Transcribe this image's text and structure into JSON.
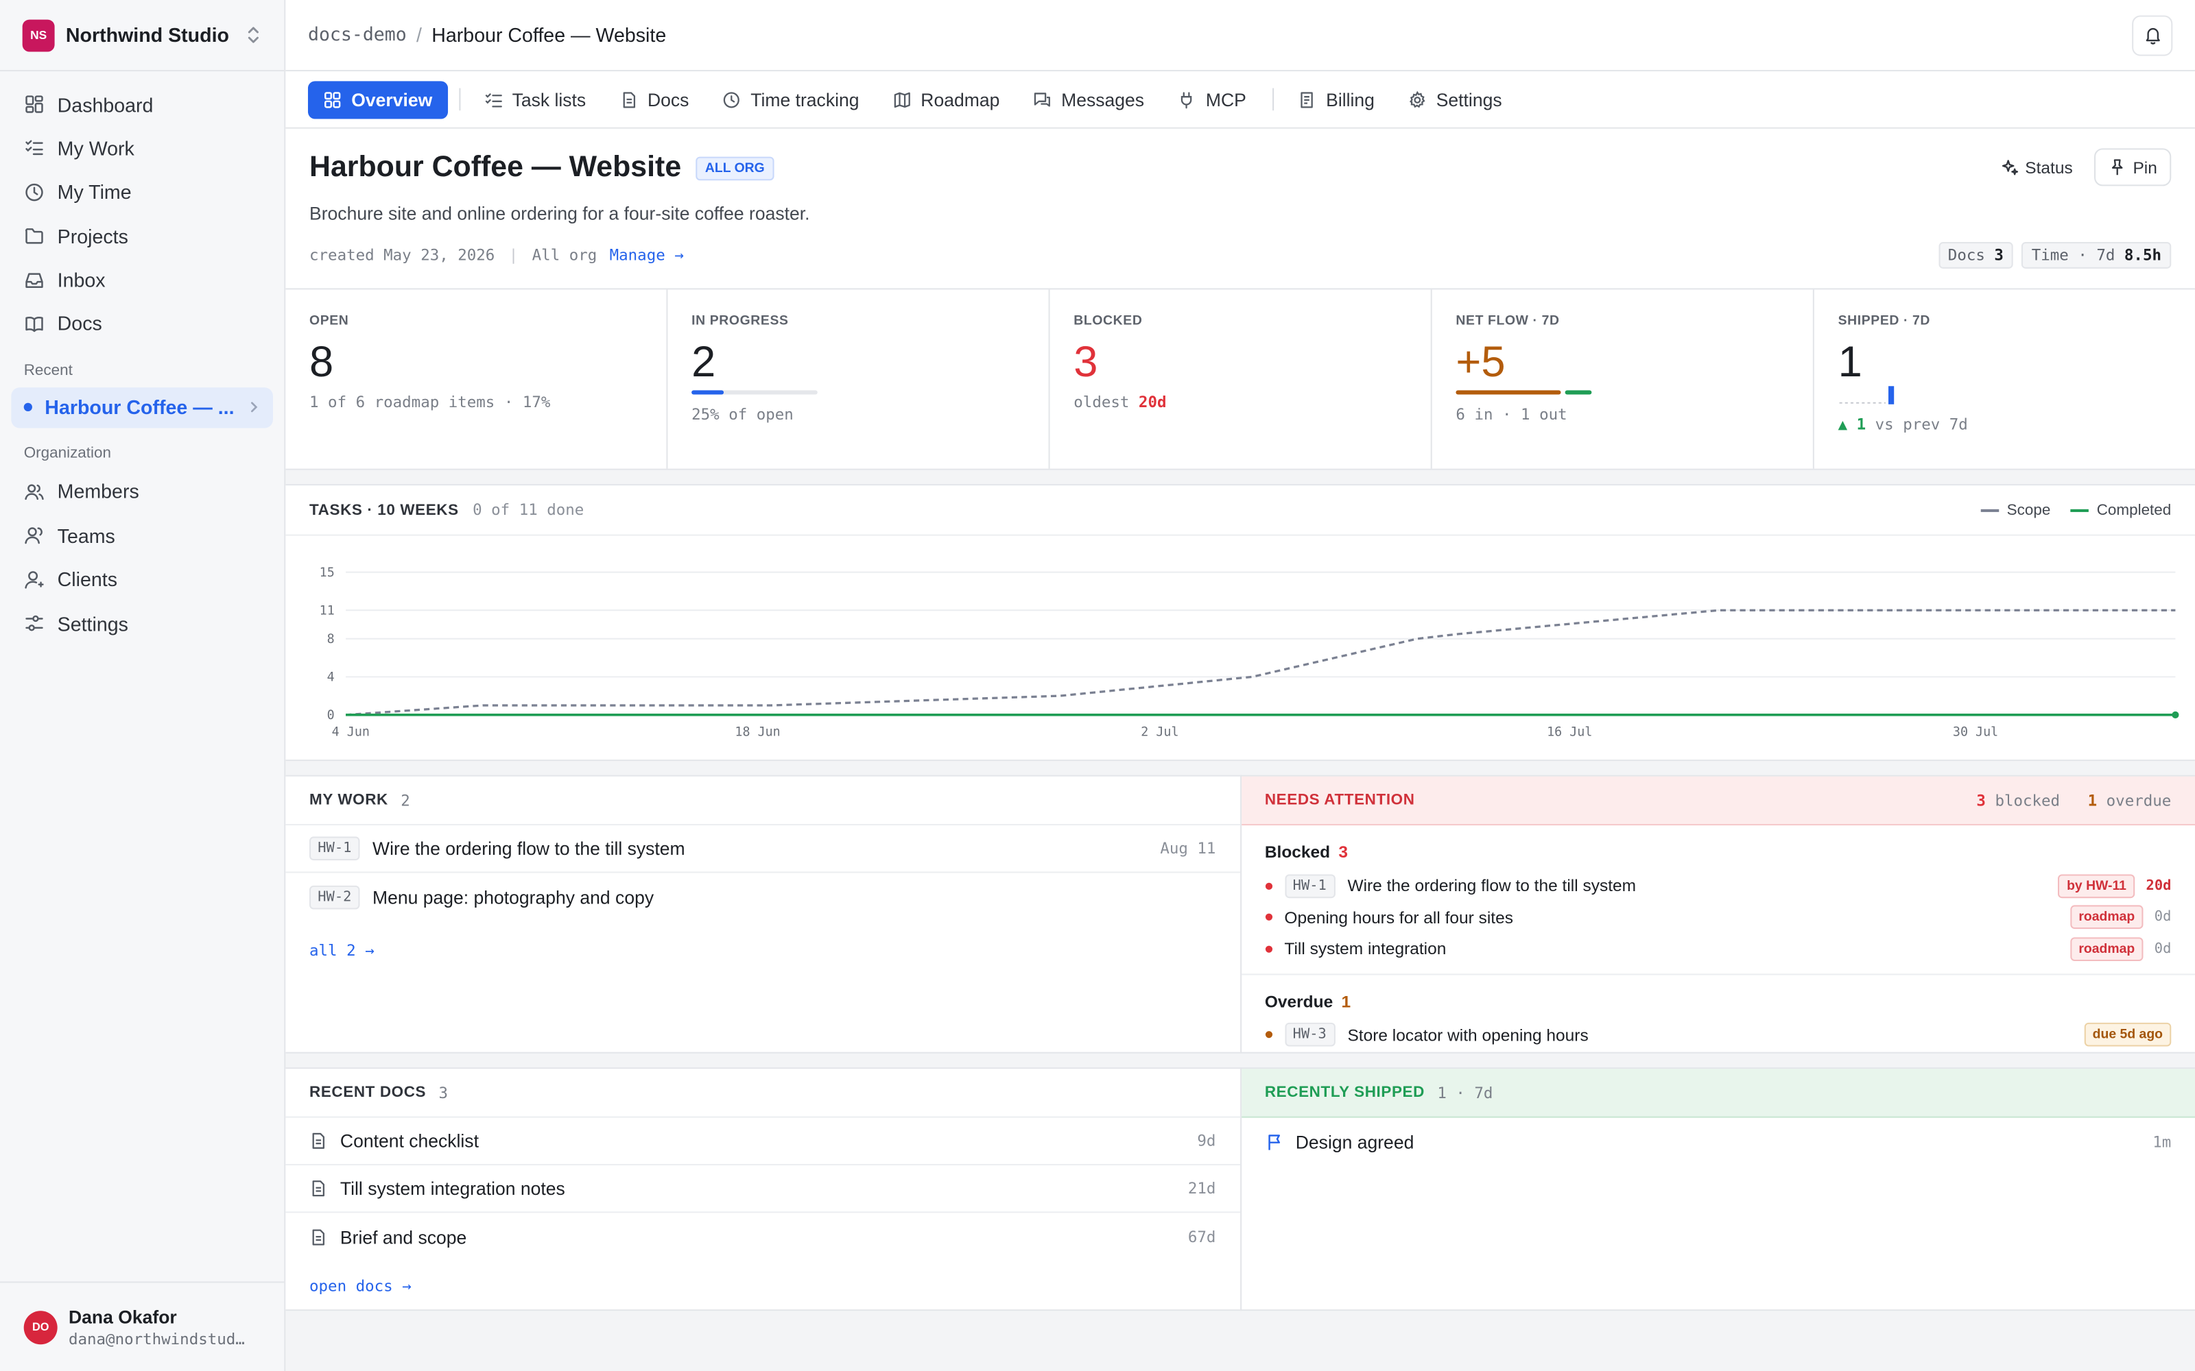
{
  "org": {
    "badge": "NS",
    "name": "Northwind Studio"
  },
  "nav": [
    {
      "label": "Dashboard",
      "icon": "dashboard-icon"
    },
    {
      "label": "My Work",
      "icon": "checklist-icon"
    },
    {
      "label": "My Time",
      "icon": "clock-icon"
    },
    {
      "label": "Projects",
      "icon": "folder-icon"
    },
    {
      "label": "Inbox",
      "icon": "inbox-icon"
    },
    {
      "label": "Docs",
      "icon": "book-icon"
    }
  ],
  "recent": {
    "label": "Recent",
    "item": "Harbour Coffee — ..."
  },
  "organization": {
    "label": "Organization",
    "items": [
      "Members",
      "Teams",
      "Clients",
      "Settings"
    ]
  },
  "user": {
    "initials": "DO",
    "name": "Dana Okafor",
    "email": "dana@northwindstud…"
  },
  "topbar": {
    "slug": "docs-demo",
    "sep": "/",
    "title": "Harbour Coffee — Website"
  },
  "tabs": [
    "Overview",
    "Task lists",
    "Docs",
    "Time tracking",
    "Roadmap",
    "Messages",
    "MCP",
    "Billing",
    "Settings"
  ],
  "project": {
    "title": "Harbour Coffee — Website",
    "scope": "ALL ORG",
    "description": "Brochure site and online ordering for a four-site coffee roaster.",
    "created": "created May 23, 2026",
    "visibility": "All org",
    "manage": "Manage →",
    "status_btn": "Status",
    "pin_btn": "Pin",
    "docs_chip_label": "Docs",
    "docs_chip_value": "3",
    "time_chip_label": "Time · 7d",
    "time_chip_value": "8.5h"
  },
  "stats": {
    "open": {
      "label": "OPEN",
      "value": "8",
      "sub": "1 of 6 roadmap items · 17%"
    },
    "in_progress": {
      "label": "IN PROGRESS",
      "value": "2",
      "sub": "25% of open",
      "fraction": 0.25
    },
    "blocked": {
      "label": "BLOCKED",
      "value": "3",
      "sub_label": "oldest",
      "sub_value": "20d"
    },
    "net_flow": {
      "label": "NET FLOW · 7D",
      "value": "+5",
      "sub": "6 in · 1 out",
      "in": 6,
      "out": 1
    },
    "shipped": {
      "label": "SHIPPED · 7D",
      "value": "1",
      "delta": "▲ 1",
      "delta_suffix": "vs prev 7d"
    }
  },
  "chart_title": "TASKS · 10 WEEKS",
  "chart_subtitle": "0 of 11 done",
  "chart_data": {
    "type": "line",
    "x_ticks": [
      "4 Jun",
      "18 Jun",
      "2 Jul",
      "16 Jul",
      "30 Jul"
    ],
    "y_ticks": [
      0,
      4,
      8,
      11,
      15
    ],
    "ylim": [
      0,
      15
    ],
    "x_range_days": [
      0,
      63
    ],
    "series": [
      {
        "name": "Scope",
        "color": "#7b8192",
        "dashed": true,
        "points": [
          [
            0,
            0
          ],
          [
            10,
            1
          ],
          [
            31,
            1
          ],
          [
            52,
            2
          ],
          [
            66,
            4
          ],
          [
            78,
            8
          ],
          [
            81,
            8.5
          ],
          [
            100,
            11
          ],
          [
            123,
            11
          ],
          [
            133.2,
            11
          ]
        ]
      },
      {
        "name": "Completed",
        "color": "#1f9d55",
        "dashed": false,
        "points": [
          [
            0,
            0
          ],
          [
            133.2,
            0
          ]
        ]
      }
    ]
  },
  "my_work": {
    "title": "MY WORK",
    "count": "2",
    "items": [
      {
        "key": "HW-1",
        "title": "Wire the ordering flow to the till system",
        "date": "Aug 11"
      },
      {
        "key": "HW-2",
        "title": "Menu page: photography and copy",
        "date": ""
      }
    ],
    "more": "all 2 →"
  },
  "attention": {
    "title": "NEEDS ATTENTION",
    "blocked_count": "3",
    "blocked_word": "blocked",
    "overdue_count": "1",
    "overdue_word": "overdue",
    "blocked_group": {
      "title": "Blocked",
      "count": "3",
      "items": [
        {
          "key": "HW-1",
          "title": "Wire the ordering flow to the till system",
          "tag": "by HW-11",
          "age": "20d"
        },
        {
          "key": "",
          "title": "Opening hours for all four sites",
          "tag": "roadmap",
          "age": "0d"
        },
        {
          "key": "",
          "title": "Till system integration",
          "tag": "roadmap",
          "age": "0d"
        }
      ]
    },
    "overdue_group": {
      "title": "Overdue",
      "count": "1",
      "items": [
        {
          "key": "HW-3",
          "title": "Store locator with opening hours",
          "tag": "due 5d ago"
        }
      ]
    }
  },
  "recent_docs": {
    "title": "RECENT DOCS",
    "count": "3",
    "items": [
      {
        "title": "Content checklist",
        "age": "9d"
      },
      {
        "title": "Till system integration notes",
        "age": "21d"
      },
      {
        "title": "Brief and scope",
        "age": "67d"
      }
    ],
    "more": "open docs →"
  },
  "shipped": {
    "title": "RECENTLY SHIPPED",
    "count": "1 · 7d",
    "items": [
      {
        "title": "Design agreed",
        "age": "1m"
      }
    ]
  },
  "colors": {
    "accent": "#2563eb",
    "danger": "#e0323a",
    "warning": "#b35c0c",
    "success": "#1f9d55",
    "brand": "#c8175d"
  }
}
